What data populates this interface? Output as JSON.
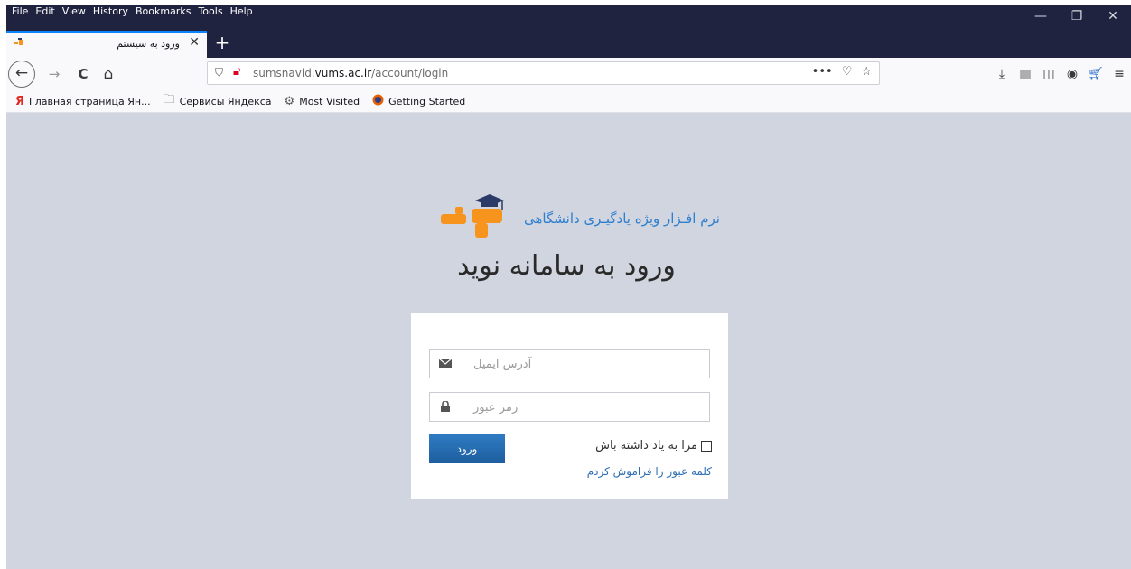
{
  "menu": [
    "File",
    "Edit",
    "View",
    "History",
    "Bookmarks",
    "Tools",
    "Help"
  ],
  "window_controls": {
    "minimize": "—",
    "restore": "❐",
    "close": "✕"
  },
  "tab": {
    "title": "ورود به سیستم",
    "close": "✕",
    "new_tab": "+"
  },
  "nav": {
    "back": "←",
    "forward": "→",
    "reload": "C",
    "home": "⌂",
    "url_prefix": "sumsnavid.",
    "url_domain": "vums.ac.ir",
    "url_path": "/account/login",
    "more": "•••",
    "pocket": "♡",
    "star": "☆"
  },
  "bookmarks": [
    {
      "label": "Главная страница Ян...",
      "icon": "yandex-icon"
    },
    {
      "label": "Сервисы Яндекса",
      "icon": "folder-icon"
    },
    {
      "label": "Most Visited",
      "icon": "gear-icon"
    },
    {
      "label": "Getting Started",
      "icon": "firefox-icon"
    }
  ],
  "page": {
    "logo_text": "نرم افـزار ویژه یادگیـری دانشگاهی",
    "heading": "ورود به سامانه نوید",
    "email_placeholder": "آدرس ایمیل",
    "password_placeholder": "رمز عبور",
    "login_button": "ورود",
    "remember_label": "مرا به یاد داشته باش",
    "forgot_link": "کلمه عبور را فراموش کردم"
  },
  "colors": {
    "accent": "#2166a8",
    "logo_orange": "#f7941d",
    "background": "#d1d5df",
    "chrome_dark": "#202340"
  }
}
